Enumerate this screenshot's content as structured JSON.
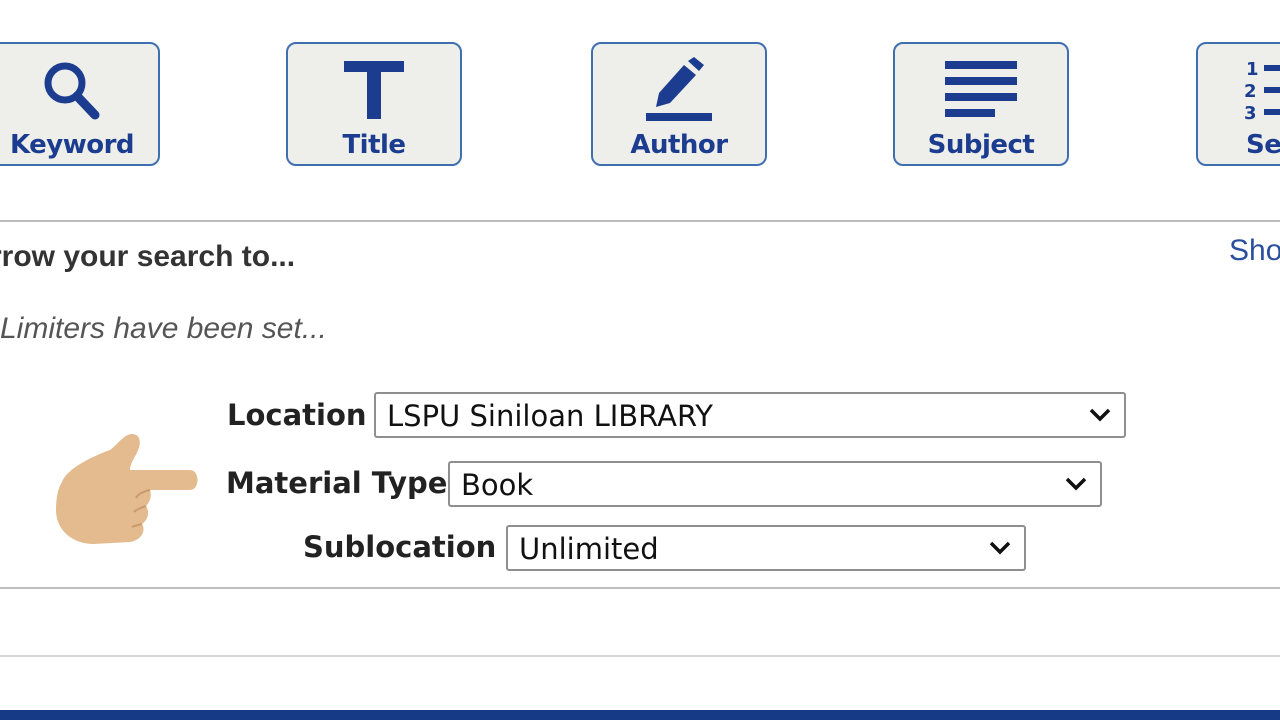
{
  "colors": {
    "accent_navy": "#1c3d8f",
    "button_border": "#3f6fb0",
    "button_fill": "#eeeeeb",
    "link_blue": "#2a4f9c",
    "footer_bar": "#163a86",
    "hand_skin": "#e3bb8f"
  },
  "search_types": [
    {
      "label": "Keyword",
      "icon": "magnifier-icon"
    },
    {
      "label": "Title",
      "icon": "letter-t-icon"
    },
    {
      "label": "Author",
      "icon": "pencil-icon"
    },
    {
      "label": "Subject",
      "icon": "lines-icon"
    },
    {
      "label": "Ser",
      "icon": "numbered-list-icon"
    }
  ],
  "narrow": {
    "heading": "rrow your search to...",
    "show_link": "Sho",
    "limiters_note": "Limiters have been set..."
  },
  "limiters": {
    "location": {
      "label": "Location",
      "value": "LSPU Siniloan LIBRARY"
    },
    "material_type": {
      "label": "Material Type",
      "value": "Book"
    },
    "sublocation": {
      "label": "Sublocation",
      "value": "Unlimited"
    }
  }
}
